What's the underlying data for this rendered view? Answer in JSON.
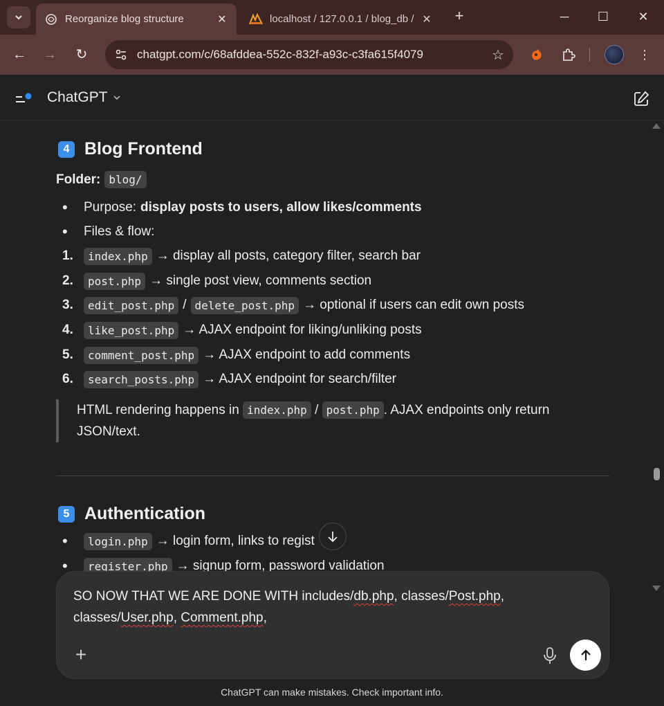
{
  "browser": {
    "tabs": [
      {
        "title": "Reorganize blog structure",
        "icon": "chatgpt-logo-icon",
        "active": true
      },
      {
        "title": "localhost / 127.0.0.1 / blog_db / ",
        "icon": "phpmyadmin-icon",
        "active": false
      }
    ],
    "url": "chatgpt.com/c/68afddea-552c-832f-a93c-c3fa615f4079",
    "colors": {
      "frame": "#3c2523",
      "toolbar": "#5a3b38"
    }
  },
  "app": {
    "title": "ChatGPT"
  },
  "section4": {
    "badge": "4",
    "title": "Blog Frontend",
    "folder_label": "Folder:",
    "folder_code": "blog/",
    "purpose_label": "Purpose:",
    "purpose_bold": "display posts to users, allow likes/comments",
    "files_label": "Files & flow:",
    "items": [
      {
        "num": "1.",
        "code": "index.php",
        "text": "→ display all posts, category filter, search bar"
      },
      {
        "num": "2.",
        "code": "post.php",
        "text": "→ single post view, comments section"
      },
      {
        "num": "3.",
        "code": "edit_post.php",
        "sep": "/",
        "code2": "delete_post.php",
        "text": "→ optional if users can edit own posts"
      },
      {
        "num": "4.",
        "code": "like_post.php",
        "text": "→ AJAX endpoint for liking/unliking posts"
      },
      {
        "num": "5.",
        "code": "comment_post.php",
        "text": "→ AJAX endpoint to add comments"
      },
      {
        "num": "6.",
        "code": "search_posts.php",
        "text": "→ AJAX endpoint for search/filter"
      }
    ],
    "note": {
      "pre": "HTML rendering happens in",
      "code1": "index.php",
      "sep": "/",
      "code2": "post.php",
      "post": ". AJAX endpoints only return",
      "line2": "JSON/text."
    }
  },
  "section5": {
    "badge": "5",
    "title": "Authentication",
    "items": [
      {
        "code": "login.php",
        "text": "→ login form, links to regist"
      },
      {
        "code": "register.php",
        "text": "→ signup form, password validation"
      }
    ]
  },
  "composer": {
    "line1_pre": "SO NOW THAT WE ARE DONE WITH includes/",
    "line1_sq1": "db.php",
    "line1_mid": ", classes/",
    "line1_sq2": "Post.php",
    "line1_end": ",",
    "line2_pre": "classes/",
    "line2_sq1": "User.php",
    "line2_mid": ", ",
    "line2_sq2": "Comment.php",
    "line2_end": ","
  },
  "footer": {
    "note": "ChatGPT can make mistakes. Check important info."
  }
}
